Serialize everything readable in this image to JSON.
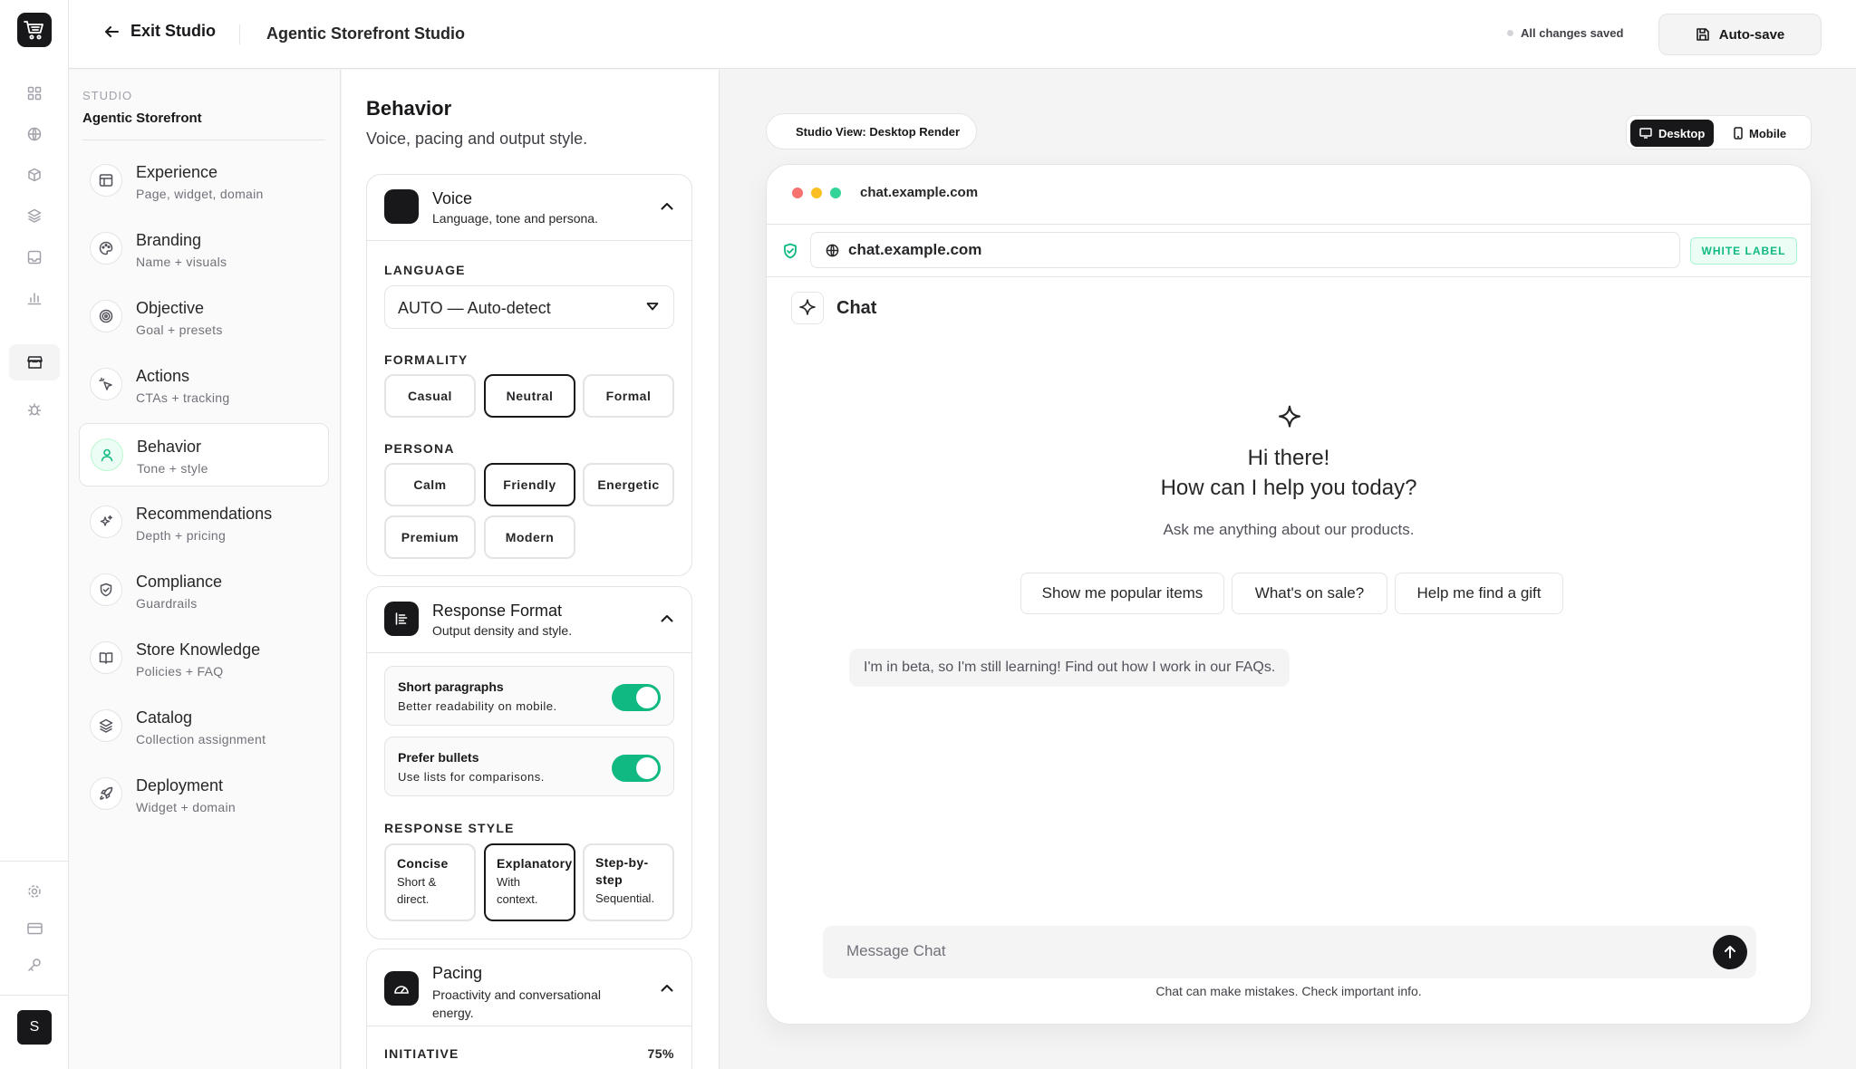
{
  "rail": {
    "avatar_letter": "S",
    "icons": [
      "cart-logo-icon",
      "grid-icon",
      "globe-icon",
      "cube-icon",
      "layers-icon",
      "inbox-icon",
      "chart-icon",
      "storefront-icon",
      "bug-icon",
      "settings-icon",
      "card-icon",
      "key-icon"
    ]
  },
  "topbar": {
    "exit_label": "Exit Studio",
    "title": "Agentic Storefront Studio",
    "status": "All changes saved",
    "autosave_label": "Auto-save"
  },
  "nav": {
    "kicker": "STUDIO",
    "name": "Agentic Storefront",
    "items": [
      {
        "title": "Experience",
        "sub": "Page, widget, domain"
      },
      {
        "title": "Branding",
        "sub": "Name + visuals"
      },
      {
        "title": "Objective",
        "sub": "Goal + presets"
      },
      {
        "title": "Actions",
        "sub": "CTAs + tracking"
      },
      {
        "title": "Behavior",
        "sub": "Tone + style"
      },
      {
        "title": "Recommendations",
        "sub": "Depth + pricing"
      },
      {
        "title": "Compliance",
        "sub": "Guardrails"
      },
      {
        "title": "Store Knowledge",
        "sub": "Policies + FAQ"
      },
      {
        "title": "Catalog",
        "sub": "Collection assignment"
      },
      {
        "title": "Deployment",
        "sub": "Widget + domain"
      }
    ],
    "active_index": 4
  },
  "panel": {
    "title": "Behavior",
    "subtitle": "Voice, pacing and output style.",
    "voice": {
      "title": "Voice",
      "sub": "Language, tone and persona.",
      "language_label": "LANGUAGE",
      "language_value": "AUTO — Auto-detect",
      "formality_label": "FORMALITY",
      "formality_options": [
        "Casual",
        "Neutral",
        "Formal"
      ],
      "formality_selected": "Neutral",
      "persona_label": "PERSONA",
      "persona_options": [
        "Calm",
        "Friendly",
        "Energetic",
        "Premium",
        "Modern"
      ],
      "persona_selected": "Friendly"
    },
    "format": {
      "title": "Response Format",
      "sub": "Output density and style.",
      "toggles": [
        {
          "title": "Short paragraphs",
          "sub": "Better readability on mobile.",
          "on": true
        },
        {
          "title": "Prefer bullets",
          "sub": "Use lists for comparisons.",
          "on": true
        }
      ],
      "style_label": "RESPONSE STYLE",
      "styles": [
        {
          "title": "Concise",
          "sub": "Short & direct."
        },
        {
          "title": "Explanatory",
          "sub": "With context."
        },
        {
          "title": "Step-by-step",
          "sub": "Sequential."
        }
      ],
      "style_selected": "Explanatory"
    },
    "pacing": {
      "title": "Pacing",
      "sub": "Proactivity and conversational energy.",
      "initiative_label": "INITIATIVE",
      "initiative_value": "75%"
    }
  },
  "preview": {
    "view_label": "Studio View: Desktop Render",
    "device_desktop": "Desktop",
    "device_mobile": "Mobile",
    "device_selected": "Desktop",
    "host": "chat.example.com",
    "url": "chat.example.com",
    "badge": "WHITE LABEL",
    "chat_title": "Chat",
    "greeting_line1": "Hi there!",
    "greeting_line2": "How can I help you today?",
    "hint": "Ask me anything about our products.",
    "suggestions": [
      "Show me popular items",
      "What's on sale?",
      "Help me find a gift"
    ],
    "beta_note": "I'm in beta, so I'm still learning! Find out how I work in our FAQs.",
    "input_placeholder": "Message Chat",
    "disclaimer": "Chat can make mistakes. Check important info."
  },
  "colors": {
    "accent": "#10b981",
    "primary": "#18181b",
    "border": "#e4e4e7",
    "traffic_red": "#f87171",
    "traffic_yellow": "#fbbf24",
    "traffic_green": "#34d399"
  }
}
